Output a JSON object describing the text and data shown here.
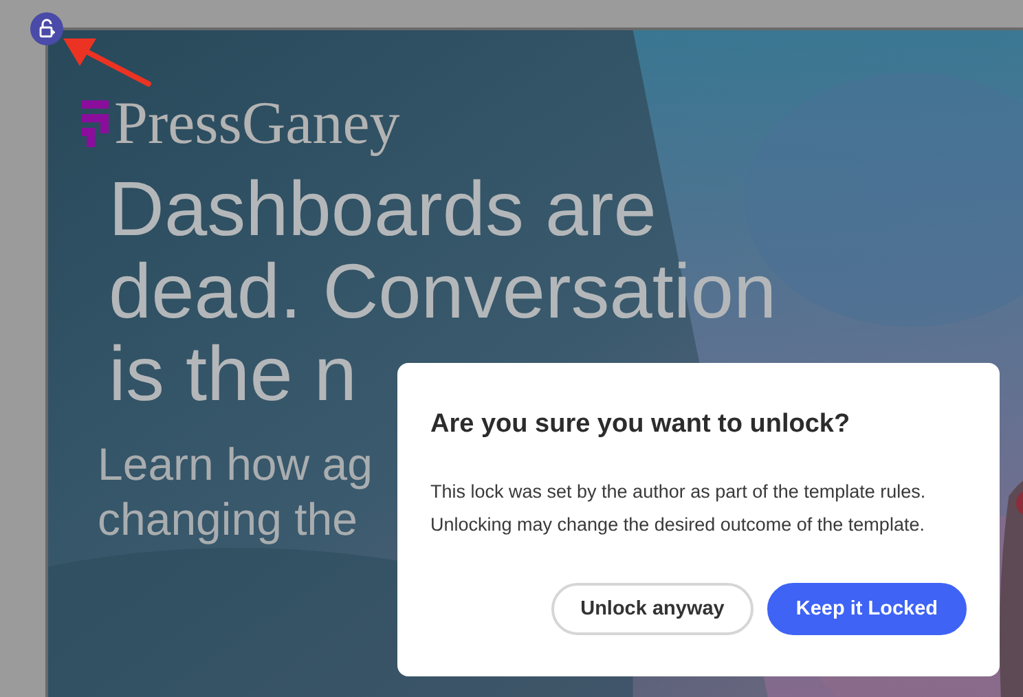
{
  "canvas": {
    "logo": "PressGaney",
    "headline": [
      "Dashboards are",
      "dead. Conversation",
      "is the n"
    ],
    "subhead": [
      "Learn how ag",
      "changing the"
    ]
  },
  "dialog": {
    "title": "Are you sure you want to unlock?",
    "body": "This lock was set by the author as part of the template rules. Unlocking may change the desired outcome of the template.",
    "buttons": [
      {
        "label": "Unlock anyway",
        "kind": "secondary"
      },
      {
        "label": "Keep it Locked",
        "kind": "primary"
      }
    ]
  }
}
